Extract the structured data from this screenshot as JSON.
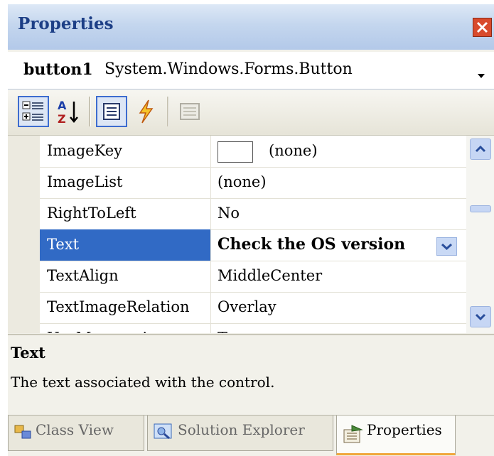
{
  "window": {
    "title": "Properties"
  },
  "selector": {
    "name": "button1",
    "type": "System.Windows.Forms.Button"
  },
  "toolbar": {
    "buttons": [
      {
        "icon": "categorized-icon",
        "active": true
      },
      {
        "icon": "alphabetical-sort-icon",
        "active": false
      },
      {
        "icon": "properties-list-icon",
        "active": true
      },
      {
        "icon": "events-lightning-icon",
        "active": false
      },
      {
        "icon": "property-pages-icon",
        "active": false
      }
    ]
  },
  "grid": {
    "rows": [
      {
        "name": "ImageKey",
        "value": "(none)"
      },
      {
        "name": "ImageList",
        "value": "(none)"
      },
      {
        "name": "RightToLeft",
        "value": "No"
      },
      {
        "name": "Text",
        "value": "Check the OS version"
      },
      {
        "name": "TextAlign",
        "value": "MiddleCenter"
      },
      {
        "name": "TextImageRelation",
        "value": "Overlay"
      },
      {
        "name": "UseMnemonic",
        "value": "True"
      }
    ],
    "selected_row": "Text"
  },
  "description": {
    "title": "Text",
    "text": "The text associated with the control."
  },
  "tabs": [
    {
      "label": "Class View",
      "icon": "class-view-icon"
    },
    {
      "label": "Solution Explorer",
      "icon": "solution-explorer-icon"
    },
    {
      "label": "Properties",
      "icon": "properties-icon"
    }
  ],
  "colors": {
    "selection": "#316ac5",
    "title_text": "#1d3f86",
    "close": "#d84a2c",
    "active_tab_underline": "#f0a73c"
  }
}
